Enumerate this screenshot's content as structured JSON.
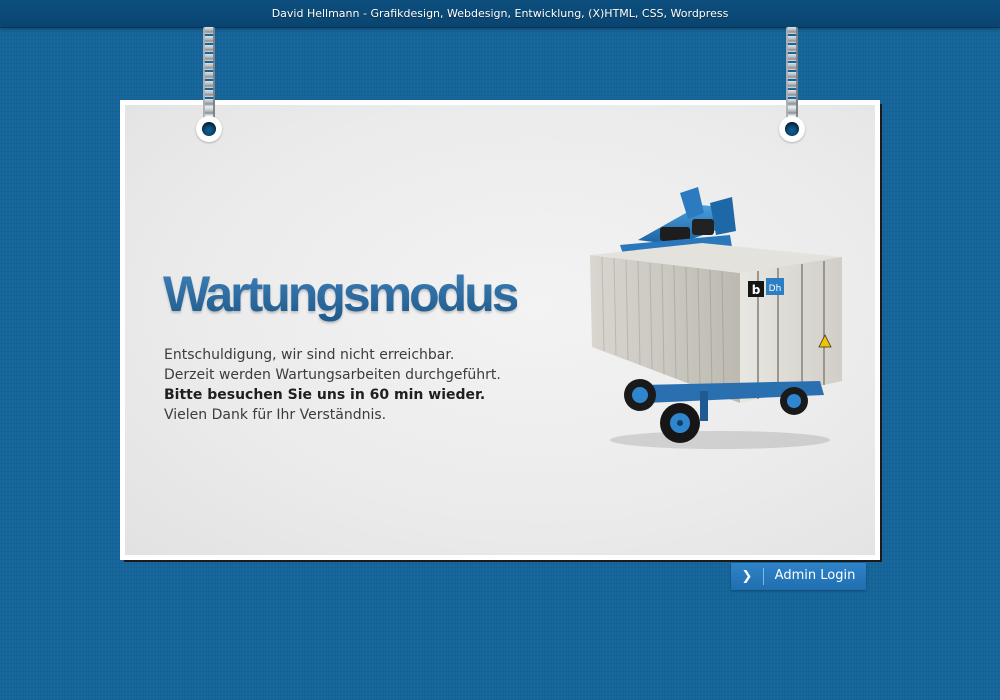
{
  "header": {
    "text": "David Hellmann - Grafikdesign, Webdesign, Entwicklung, (X)HTML, CSS, Wordpress"
  },
  "card": {
    "title": "Wartungsmodus",
    "lines": [
      "Entschuldigung, wir sind nicht erreichbar.",
      "Derzeit werden Wartungsarbeiten durchgeführt.",
      "Bitte besuchen Sie uns in 60 min wieder.",
      "Vielen Dank für Ihr Verständnis."
    ],
    "container_logo_left": "b",
    "container_logo_right": "Dh"
  },
  "admin_login": {
    "icon": "chevron-right-icon",
    "label": "Admin Login"
  },
  "colors": {
    "background": "#15649a",
    "header_bar": "#0b4a78",
    "title": "#2b6aa1",
    "button": "#2a7dc0"
  }
}
